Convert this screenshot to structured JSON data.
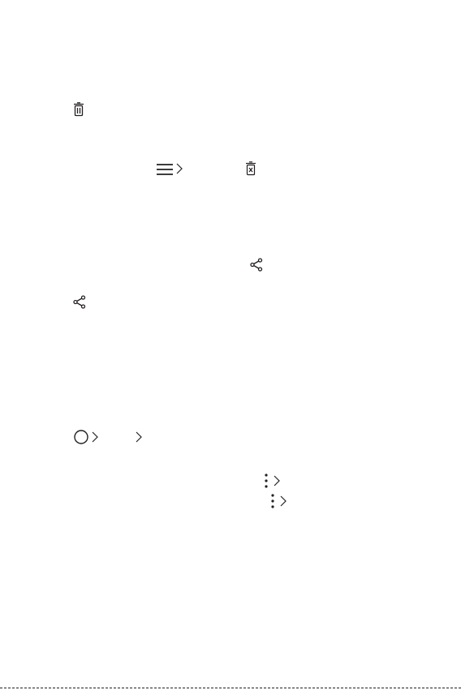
{
  "page": {
    "background": "#ffffff",
    "ink": "#231f20"
  },
  "icons": [
    {
      "name": "delete-icon",
      "glyph": "trash-can"
    },
    {
      "name": "menu-icon",
      "glyph": "three-lines"
    },
    {
      "name": "chevron-right-icon",
      "glyph": ">"
    },
    {
      "name": "trash-bin-icon",
      "glyph": "trash-can-with-x"
    },
    {
      "name": "share-icon",
      "glyph": "share-nodes"
    },
    {
      "name": "home-circle-icon",
      "glyph": "circle"
    },
    {
      "name": "more-options-icon",
      "glyph": "vertical-ellipsis"
    }
  ]
}
